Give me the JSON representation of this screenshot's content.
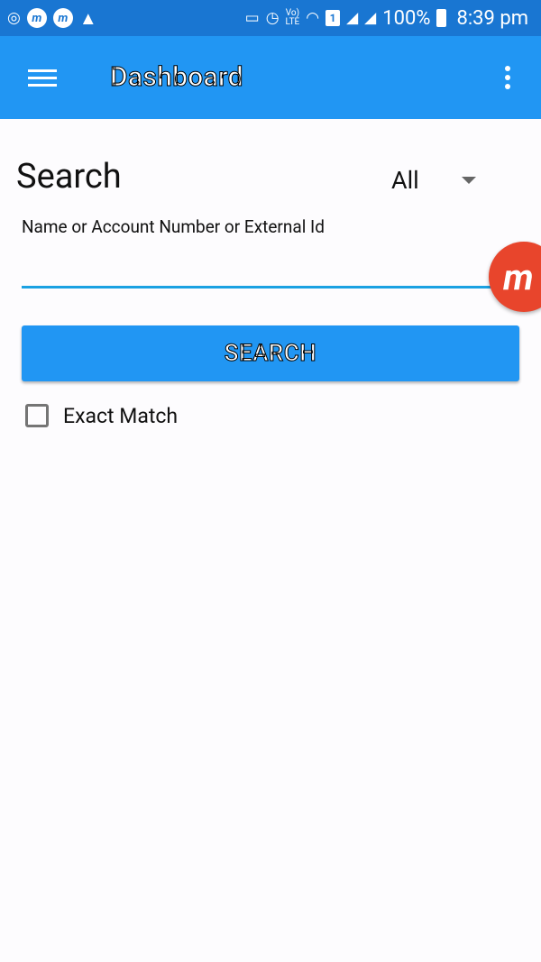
{
  "status_bar": {
    "left_icons": [
      "whatsapp-icon",
      "messenger-icon",
      "messenger-lite-icon",
      "warning-icon"
    ],
    "right_icons": [
      "cast-icon",
      "alarm-icon",
      "volte-icon",
      "wifi-icon",
      "sim-icon",
      "signal-icon",
      "signal-2-icon",
      "battery-icon"
    ],
    "volte_line1": "Vo)",
    "volte_line2": "LTE",
    "sim_number": "1",
    "battery_percent": "100%",
    "time": "8:39 pm"
  },
  "app_bar": {
    "title": "Dashboard",
    "background": "#2196f3",
    "menu_icon": "menu-icon",
    "overflow_icon": "more-vert-icon"
  },
  "search": {
    "heading": "Search",
    "filter_selected": "All",
    "field_label": "Name or Account Number or External Id",
    "input_value": "",
    "button_label": "SEARCH",
    "exact_match_label": "Exact Match",
    "exact_match_checked": false,
    "accent": "#1ba1e2"
  },
  "overlay": {
    "badge_letter": "m",
    "badge_color": "#e8452c"
  }
}
